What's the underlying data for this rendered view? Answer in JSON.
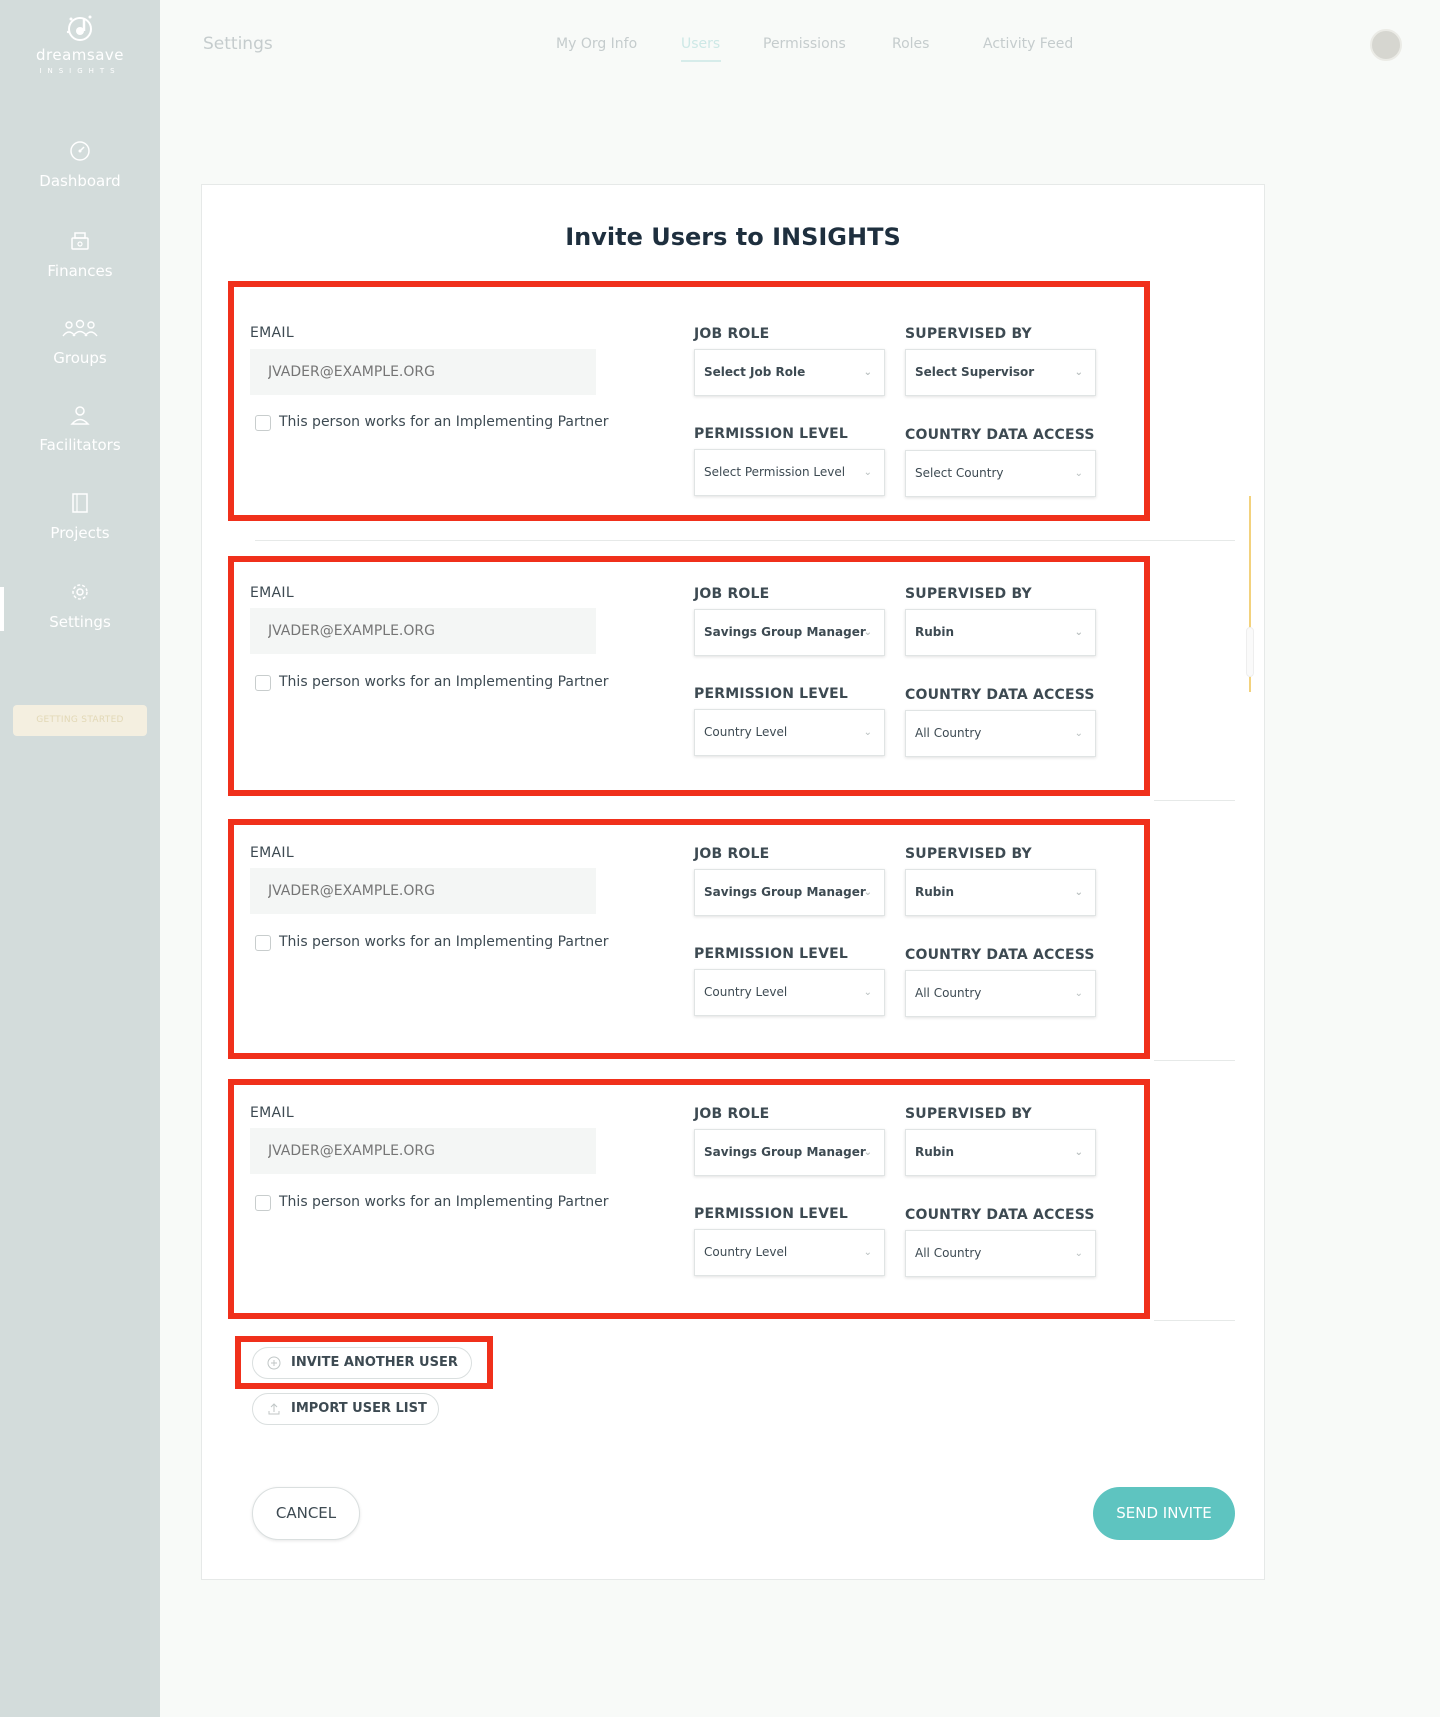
{
  "app": {
    "logo_name": "dreamsave",
    "logo_sub": "INSIGHTS"
  },
  "sidebar": {
    "items": [
      {
        "label": "Dashboard",
        "icon": "gauge-icon"
      },
      {
        "label": "Finances",
        "icon": "cash-register-icon"
      },
      {
        "label": "Groups",
        "icon": "group-icon"
      },
      {
        "label": "Facilitators",
        "icon": "person-icon"
      },
      {
        "label": "Projects",
        "icon": "notebook-icon"
      },
      {
        "label": "Settings",
        "icon": "gear-icon",
        "active": true
      }
    ],
    "getting_started": "GETTING STARTED"
  },
  "topbar": {
    "title": "Settings",
    "tabs": [
      {
        "label": "My Org Info"
      },
      {
        "label": "Users",
        "active": true
      },
      {
        "label": "Permissions"
      },
      {
        "label": "Roles"
      },
      {
        "label": "Activity Feed"
      }
    ]
  },
  "form": {
    "title": "Invite Users to INSIGHTS",
    "labels": {
      "email": "EMAIL",
      "job_role": "JOB ROLE",
      "supervised_by": "SUPERVISED BY",
      "permission_level": "PERMISSION LEVEL",
      "country_data_access": "COUNTRY DATA ACCESS",
      "partner_checkbox": "This person works for an Implementing Partner"
    },
    "entries": [
      {
        "email_placeholder": "JVADER@EXAMPLE.ORG",
        "job_role": "Select Job Role",
        "supervised_by": "Select Supervisor",
        "permission_level": "Select Permission Level",
        "country": "Select Country",
        "partner": false
      },
      {
        "email_placeholder": "JVADER@EXAMPLE.ORG",
        "job_role": "Savings Group Manager",
        "supervised_by": "Rubin",
        "permission_level": "Country Level",
        "country": "All Country",
        "partner": false
      },
      {
        "email_placeholder": "JVADER@EXAMPLE.ORG",
        "job_role": "Savings Group Manager",
        "supervised_by": "Rubin",
        "permission_level": "Country Level",
        "country": "All Country",
        "partner": false
      },
      {
        "email_placeholder": "JVADER@EXAMPLE.ORG",
        "job_role": "Savings Group Manager",
        "supervised_by": "Rubin",
        "permission_level": "Country Level",
        "country": "All Country",
        "partner": false
      }
    ],
    "invite_another": "INVITE ANOTHER USER",
    "import_list": "IMPORT USER LIST",
    "cancel": "CANCEL",
    "send": "SEND INVITE"
  },
  "colors": {
    "sidebar_bg": "#d3dcdb",
    "accent": "#5ec4c0",
    "highlight_box": "#f0301b",
    "title": "#1e2f3e"
  }
}
